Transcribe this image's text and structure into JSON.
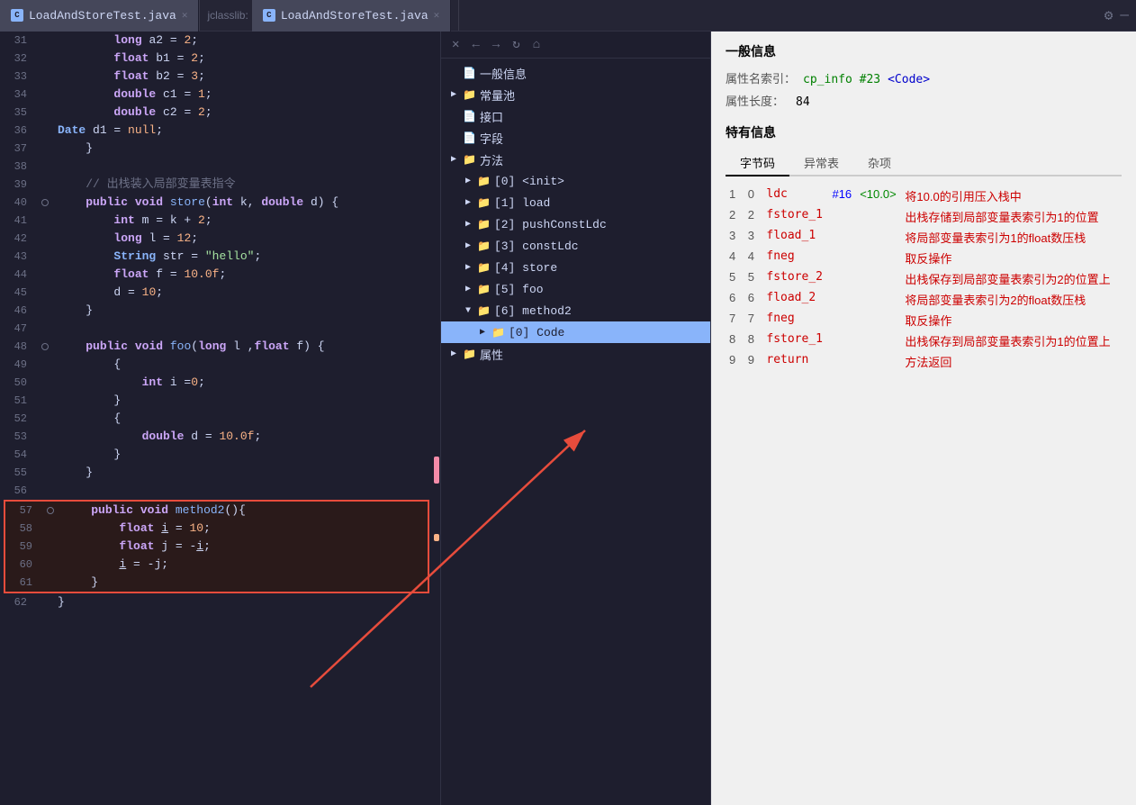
{
  "tabs": {
    "left_tab": "LoadAndStoreTest.java",
    "right_prefix": "jclasslib:",
    "right_tab": "LoadAndStoreTest.java"
  },
  "toolbar": {
    "close": "✕",
    "back": "←",
    "forward": "→",
    "refresh": "↻",
    "home": "⌂"
  },
  "tree": {
    "items": [
      {
        "id": 0,
        "level": 0,
        "label": "一般信息",
        "type": "doc",
        "expanded": false,
        "selected": false
      },
      {
        "id": 1,
        "level": 0,
        "label": "常量池",
        "type": "folder",
        "expanded": false,
        "selected": false
      },
      {
        "id": 2,
        "level": 0,
        "label": "接口",
        "type": "doc",
        "expanded": false,
        "selected": false
      },
      {
        "id": 3,
        "level": 0,
        "label": "字段",
        "type": "doc",
        "expanded": false,
        "selected": false
      },
      {
        "id": 4,
        "level": 0,
        "label": "方法",
        "type": "folder",
        "expanded": true,
        "selected": false
      },
      {
        "id": 5,
        "level": 1,
        "label": "[0] <init>",
        "type": "folder",
        "expanded": false,
        "selected": false,
        "has_expand": true
      },
      {
        "id": 6,
        "level": 1,
        "label": "[1] load",
        "type": "folder",
        "expanded": false,
        "selected": false,
        "has_expand": true
      },
      {
        "id": 7,
        "level": 1,
        "label": "[2] pushConstLdc",
        "type": "folder",
        "expanded": false,
        "selected": false,
        "has_expand": true
      },
      {
        "id": 8,
        "level": 1,
        "label": "[3] constLdc",
        "type": "folder",
        "expanded": false,
        "selected": false,
        "has_expand": true
      },
      {
        "id": 9,
        "level": 1,
        "label": "[4] store",
        "type": "folder",
        "expanded": false,
        "selected": false,
        "has_expand": true
      },
      {
        "id": 10,
        "level": 1,
        "label": "[5] foo",
        "type": "folder",
        "expanded": false,
        "selected": false,
        "has_expand": true
      },
      {
        "id": 11,
        "level": 1,
        "label": "[6] method2",
        "type": "folder",
        "expanded": true,
        "selected": false,
        "has_expand": true
      },
      {
        "id": 12,
        "level": 2,
        "label": "[0] Code",
        "type": "folder",
        "expanded": false,
        "selected": true,
        "has_expand": true
      },
      {
        "id": 13,
        "level": 0,
        "label": "属性",
        "type": "folder",
        "expanded": false,
        "selected": false
      }
    ]
  },
  "info_panel": {
    "title": "一般信息",
    "attr_label": "属性名索引：",
    "attr_value": "cp_info #23",
    "attr_code": "<Code>",
    "length_label": "属性长度：",
    "length_value": "84",
    "special_title": "特有信息",
    "tabs": [
      "字节码",
      "异常表",
      "杂项"
    ],
    "active_tab": "字节码",
    "bytecode": [
      {
        "line": "1",
        "offset": "0",
        "instr": "ldc",
        "ref": "#16",
        "extra": "<10.0>",
        "desc": "将10.0的引用压入栈中"
      },
      {
        "line": "2",
        "offset": "2",
        "instr": "fstore_1",
        "ref": "",
        "extra": "",
        "desc": "出栈存储到局部变量表索引为1的位置"
      },
      {
        "line": "3",
        "offset": "3",
        "instr": "fload_1",
        "ref": "",
        "extra": "",
        "desc": "将局部变量表索引为1的float数压栈"
      },
      {
        "line": "4",
        "offset": "4",
        "instr": "fneg",
        "ref": "",
        "extra": "",
        "desc": "取反操作"
      },
      {
        "line": "5",
        "offset": "5",
        "instr": "fstore_2",
        "ref": "",
        "extra": "",
        "desc": "出栈保存到局部变量表索引为2的位置上"
      },
      {
        "line": "6",
        "offset": "6",
        "instr": "fload_2",
        "ref": "",
        "extra": "",
        "desc": "将局部变量表索引为2的float数压栈"
      },
      {
        "line": "7",
        "offset": "7",
        "instr": "fneg",
        "ref": "",
        "extra": "",
        "desc": "取反操作"
      },
      {
        "line": "8",
        "offset": "8",
        "instr": "fstore_1",
        "ref": "",
        "extra": "",
        "desc": "出栈保存到局部变量表索引为1的位置上"
      },
      {
        "line": "9",
        "offset": "9",
        "instr": "return",
        "ref": "",
        "extra": "",
        "desc": "方法返回"
      }
    ]
  },
  "code_lines": [
    {
      "num": "31",
      "content": "        long a2 = 2;",
      "tokens": [
        {
          "t": "sp",
          "v": "        "
        },
        {
          "t": "kw",
          "v": "long"
        },
        {
          "t": "plain",
          "v": " a2 = "
        },
        {
          "t": "num",
          "v": "2"
        },
        {
          "t": "plain",
          "v": ";"
        }
      ]
    },
    {
      "num": "32",
      "content": "        float b1 = 2;",
      "tokens": [
        {
          "t": "sp",
          "v": "        "
        },
        {
          "t": "kw",
          "v": "float"
        },
        {
          "t": "plain",
          "v": " b1 = "
        },
        {
          "t": "num",
          "v": "2"
        },
        {
          "t": "plain",
          "v": ";"
        }
      ]
    },
    {
      "num": "33",
      "content": "        float b2 = 3;",
      "tokens": [
        {
          "t": "sp",
          "v": "        "
        },
        {
          "t": "kw",
          "v": "float"
        },
        {
          "t": "plain",
          "v": " b2 = "
        },
        {
          "t": "num",
          "v": "3"
        },
        {
          "t": "plain",
          "v": ";"
        }
      ]
    },
    {
      "num": "34",
      "content": "        double c1 = 1;",
      "tokens": [
        {
          "t": "sp",
          "v": "        "
        },
        {
          "t": "kw",
          "v": "double"
        },
        {
          "t": "plain",
          "v": " c1 = "
        },
        {
          "t": "num",
          "v": "1"
        },
        {
          "t": "plain",
          "v": ";"
        }
      ]
    },
    {
      "num": "35",
      "content": "        double c2 = 2;",
      "tokens": [
        {
          "t": "sp",
          "v": "        "
        },
        {
          "t": "kw",
          "v": "double"
        },
        {
          "t": "plain",
          "v": " c2 = "
        },
        {
          "t": "num",
          "v": "2"
        },
        {
          "t": "plain",
          "v": ";"
        }
      ]
    },
    {
      "num": "36",
      "content": "        Date d1 = null;",
      "tokens": [
        {
          "t": "type",
          "v": "Date"
        },
        {
          "t": "plain",
          "v": " d1 = "
        },
        {
          "t": "null",
          "v": "null"
        },
        {
          "t": "plain",
          "v": ";"
        }
      ],
      "indent": "        "
    },
    {
      "num": "37",
      "content": "    }",
      "tokens": [
        {
          "t": "plain",
          "v": "    }"
        }
      ]
    },
    {
      "num": "38",
      "content": "",
      "tokens": []
    },
    {
      "num": "39",
      "content": "    // 出栈装入局部变量表指令",
      "tokens": [
        {
          "t": "sp",
          "v": "    "
        },
        {
          "t": "comment",
          "v": "// 出栈装入局部变量表指令"
        }
      ]
    },
    {
      "num": "40",
      "content": "    public void store(int k, double d) {",
      "tokens": [
        {
          "t": "sp",
          "v": "    "
        },
        {
          "t": "kw",
          "v": "public"
        },
        {
          "t": "plain",
          "v": " "
        },
        {
          "t": "kw",
          "v": "void"
        },
        {
          "t": "plain",
          "v": " "
        },
        {
          "t": "method",
          "v": "store"
        },
        {
          "t": "plain",
          "v": "("
        },
        {
          "t": "kw",
          "v": "int"
        },
        {
          "t": "plain",
          "v": " k, "
        },
        {
          "t": "kw",
          "v": "double"
        },
        {
          "t": "plain",
          "v": " d) {"
        }
      ]
    },
    {
      "num": "41",
      "content": "        int m = k + 2;",
      "tokens": [
        {
          "t": "sp",
          "v": "        "
        },
        {
          "t": "kw",
          "v": "int"
        },
        {
          "t": "plain",
          "v": " m = k + "
        },
        {
          "t": "num",
          "v": "2"
        },
        {
          "t": "plain",
          "v": ";"
        }
      ]
    },
    {
      "num": "42",
      "content": "        long l = 12;",
      "tokens": [
        {
          "t": "sp",
          "v": "        "
        },
        {
          "t": "kw",
          "v": "long"
        },
        {
          "t": "plain",
          "v": " l = "
        },
        {
          "t": "num",
          "v": "12"
        },
        {
          "t": "plain",
          "v": ";"
        }
      ]
    },
    {
      "num": "43",
      "content": "        String str = \"hello\";",
      "tokens": [
        {
          "t": "sp",
          "v": "        "
        },
        {
          "t": "type",
          "v": "String"
        },
        {
          "t": "plain",
          "v": " str = "
        },
        {
          "t": "str",
          "v": "\"hello\""
        },
        {
          "t": "plain",
          "v": ";"
        }
      ]
    },
    {
      "num": "44",
      "content": "        float f = 10.0f;",
      "tokens": [
        {
          "t": "sp",
          "v": "        "
        },
        {
          "t": "kw",
          "v": "float"
        },
        {
          "t": "plain",
          "v": " f = "
        },
        {
          "t": "num",
          "v": "10.0f"
        },
        {
          "t": "plain",
          "v": ";"
        }
      ]
    },
    {
      "num": "45",
      "content": "        d = 10;",
      "tokens": [
        {
          "t": "sp",
          "v": "        "
        },
        {
          "t": "plain",
          "v": "d = "
        },
        {
          "t": "num",
          "v": "10"
        },
        {
          "t": "plain",
          "v": ";"
        }
      ]
    },
    {
      "num": "46",
      "content": "    }",
      "tokens": [
        {
          "t": "plain",
          "v": "    }"
        }
      ]
    },
    {
      "num": "47",
      "content": "",
      "tokens": []
    },
    {
      "num": "48",
      "content": "    public void foo(long l ,float f) {",
      "tokens": [
        {
          "t": "sp",
          "v": "    "
        },
        {
          "t": "kw",
          "v": "public"
        },
        {
          "t": "plain",
          "v": " "
        },
        {
          "t": "kw",
          "v": "void"
        },
        {
          "t": "plain",
          "v": " "
        },
        {
          "t": "method",
          "v": "foo"
        },
        {
          "t": "plain",
          "v": "("
        },
        {
          "t": "kw",
          "v": "long"
        },
        {
          "t": "plain",
          "v": " l ,"
        },
        {
          "t": "kw",
          "v": "float"
        },
        {
          "t": "plain",
          "v": " f) {"
        }
      ]
    },
    {
      "num": "49",
      "content": "        {",
      "tokens": [
        {
          "t": "plain",
          "v": "        {"
        }
      ]
    },
    {
      "num": "50",
      "content": "            int i =0;",
      "tokens": [
        {
          "t": "sp",
          "v": "            "
        },
        {
          "t": "kw",
          "v": "int"
        },
        {
          "t": "plain",
          "v": " i ="
        },
        {
          "t": "num",
          "v": "0"
        },
        {
          "t": "plain",
          "v": ";"
        }
      ]
    },
    {
      "num": "51",
      "content": "        }",
      "tokens": [
        {
          "t": "plain",
          "v": "        }"
        }
      ]
    },
    {
      "num": "52",
      "content": "        {",
      "tokens": [
        {
          "t": "plain",
          "v": "        {"
        }
      ]
    },
    {
      "num": "53",
      "content": "            double d = 10.0f;",
      "tokens": [
        {
          "t": "sp",
          "v": "            "
        },
        {
          "t": "kw",
          "v": "double"
        },
        {
          "t": "plain",
          "v": " d = "
        },
        {
          "t": "num",
          "v": "10.0f"
        },
        {
          "t": "plain",
          "v": ";"
        }
      ]
    },
    {
      "num": "54",
      "content": "        }",
      "tokens": [
        {
          "t": "plain",
          "v": "        }"
        }
      ]
    },
    {
      "num": "55",
      "content": "    }",
      "tokens": [
        {
          "t": "plain",
          "v": "    }"
        }
      ]
    },
    {
      "num": "56",
      "content": "",
      "tokens": []
    },
    {
      "num": "57",
      "content": "    public void method2(){",
      "tokens": [
        {
          "t": "sp",
          "v": "    "
        },
        {
          "t": "kw",
          "v": "public"
        },
        {
          "t": "plain",
          "v": " "
        },
        {
          "t": "kw",
          "v": "void"
        },
        {
          "t": "plain",
          "v": " "
        },
        {
          "t": "method",
          "v": "method2"
        },
        {
          "t": "plain",
          "v": "(){"
        }
      ],
      "highlight": true
    },
    {
      "num": "58",
      "content": "        float i = 10;",
      "tokens": [
        {
          "t": "sp",
          "v": "        "
        },
        {
          "t": "kw",
          "v": "float"
        },
        {
          "t": "plain",
          "v": " "
        },
        {
          "t": "uvar",
          "v": "i"
        },
        {
          "t": "plain",
          "v": " = "
        },
        {
          "t": "num",
          "v": "10"
        },
        {
          "t": "plain",
          "v": ";"
        }
      ],
      "highlight": true
    },
    {
      "num": "59",
      "content": "        float j = -i;",
      "tokens": [
        {
          "t": "sp",
          "v": "        "
        },
        {
          "t": "kw",
          "v": "float"
        },
        {
          "t": "plain",
          "v": " j = -"
        },
        {
          "t": "uvar",
          "v": "i"
        },
        {
          "t": "plain",
          "v": ";"
        }
      ],
      "highlight": true
    },
    {
      "num": "60",
      "content": "        i = -j;",
      "tokens": [
        {
          "t": "sp",
          "v": "        "
        },
        {
          "t": "uvar",
          "v": "i"
        },
        {
          "t": "plain",
          "v": " = -j;"
        }
      ],
      "highlight": true
    },
    {
      "num": "61",
      "content": "    }",
      "tokens": [
        {
          "t": "plain",
          "v": "    }"
        }
      ],
      "highlight": true
    },
    {
      "num": "62",
      "content": "}",
      "tokens": [
        {
          "t": "plain",
          "v": "}"
        }
      ]
    }
  ]
}
